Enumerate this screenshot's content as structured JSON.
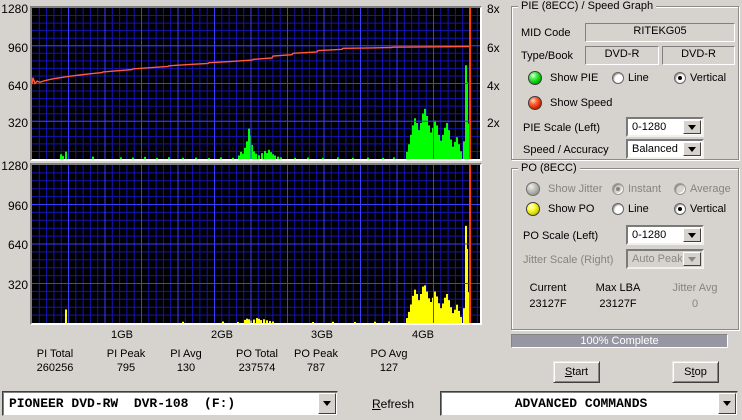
{
  "colors": {
    "bg": "#d6d3ce",
    "grid_minor": "#1414b4",
    "grid_major": "#3c3cff",
    "pie_bar": "#00ff00",
    "po_bar": "#ffff00",
    "speed_line": "#ff5a3c",
    "marker": "#ff3c00",
    "progress_fill": "#9797a4"
  },
  "chart_data": {
    "type": "bar",
    "pie_graph": {
      "title": "PIE (8ECC)",
      "ylim": [
        0,
        1280
      ],
      "y_ticks": [
        "1280",
        "960",
        "640",
        "320"
      ],
      "right_ticks": [
        "8x",
        "6x",
        "4x",
        "2x"
      ],
      "marker_x": 438,
      "bars": [
        [
          28,
          40
        ],
        [
          30,
          26
        ],
        [
          33,
          62
        ],
        [
          60,
          20
        ],
        [
          88,
          14
        ],
        [
          100,
          12
        ],
        [
          112,
          18
        ],
        [
          124,
          10
        ],
        [
          136,
          15
        ],
        [
          150,
          10
        ],
        [
          163,
          12
        ],
        [
          176,
          8
        ],
        [
          188,
          14
        ],
        [
          200,
          10
        ],
        [
          206,
          30
        ],
        [
          208,
          60
        ],
        [
          210,
          45
        ],
        [
          212,
          95
        ],
        [
          214,
          150
        ],
        [
          216,
          258
        ],
        [
          217,
          200
        ],
        [
          219,
          120
        ],
        [
          221,
          65
        ],
        [
          223,
          45
        ],
        [
          226,
          32
        ],
        [
          229,
          50
        ],
        [
          232,
          68
        ],
        [
          234,
          50
        ],
        [
          236,
          78
        ],
        [
          238,
          58
        ],
        [
          240,
          40
        ],
        [
          242,
          30
        ],
        [
          245,
          20
        ],
        [
          248,
          14
        ],
        [
          262,
          10
        ],
        [
          275,
          12
        ],
        [
          290,
          10
        ],
        [
          305,
          14
        ],
        [
          320,
          10
        ],
        [
          335,
          12
        ],
        [
          350,
          10
        ],
        [
          361,
          14
        ],
        [
          374,
          60
        ],
        [
          376,
          125
        ],
        [
          378,
          205
        ],
        [
          380,
          285
        ],
        [
          382,
          345
        ],
        [
          384,
          305
        ],
        [
          386,
          245
        ],
        [
          388,
          305
        ],
        [
          390,
          385
        ],
        [
          392,
          425
        ],
        [
          394,
          365
        ],
        [
          396,
          285
        ],
        [
          398,
          225
        ],
        [
          400,
          265
        ],
        [
          402,
          325
        ],
        [
          404,
          285
        ],
        [
          406,
          205
        ],
        [
          408,
          155
        ],
        [
          410,
          205
        ],
        [
          412,
          265
        ],
        [
          414,
          305
        ],
        [
          416,
          245
        ],
        [
          418,
          165
        ],
        [
          420,
          105
        ],
        [
          422,
          145
        ],
        [
          424,
          185
        ],
        [
          426,
          125
        ],
        [
          428,
          65
        ],
        [
          431,
          150
        ],
        [
          433,
          795
        ],
        [
          434,
          650
        ],
        [
          435,
          300
        ]
      ],
      "speed_line": [
        [
          0,
          635
        ],
        [
          1,
          690
        ],
        [
          3,
          640
        ],
        [
          5,
          660
        ],
        [
          8,
          650
        ],
        [
          12,
          662
        ],
        [
          17,
          672
        ],
        [
          23,
          682
        ],
        [
          30,
          692
        ],
        [
          38,
          702
        ],
        [
          48,
          712
        ],
        [
          58,
          722
        ],
        [
          70,
          732
        ],
        [
          71,
          738
        ],
        [
          85,
          748
        ],
        [
          100,
          758
        ],
        [
          101,
          764
        ],
        [
          118,
          774
        ],
        [
          136,
          784
        ],
        [
          137,
          790
        ],
        [
          156,
          800
        ],
        [
          176,
          810
        ],
        [
          177,
          816
        ],
        [
          198,
          826
        ],
        [
          220,
          838
        ],
        [
          221,
          844
        ],
        [
          240,
          856
        ],
        [
          241,
          872
        ],
        [
          260,
          884
        ],
        [
          261,
          896
        ],
        [
          285,
          908
        ],
        [
          286,
          920
        ],
        [
          310,
          930
        ],
        [
          311,
          938
        ],
        [
          340,
          942
        ],
        [
          360,
          945
        ],
        [
          361,
          948
        ],
        [
          390,
          950
        ],
        [
          420,
          952
        ],
        [
          438,
          953
        ]
      ]
    },
    "po_graph": {
      "title": "PO (8ECC)",
      "ylim": [
        0,
        1280
      ],
      "y_ticks": [
        "1280",
        "960",
        "640",
        "320"
      ],
      "marker_x": 438,
      "bars": [
        [
          33,
          110
        ],
        [
          150,
          10
        ],
        [
          190,
          12
        ],
        [
          205,
          8
        ],
        [
          212,
          25
        ],
        [
          214,
          35
        ],
        [
          216,
          30
        ],
        [
          218,
          20
        ],
        [
          221,
          28
        ],
        [
          224,
          40
        ],
        [
          226,
          34
        ],
        [
          228,
          24
        ],
        [
          231,
          30
        ],
        [
          234,
          22
        ],
        [
          237,
          16
        ],
        [
          240,
          12
        ],
        [
          280,
          8
        ],
        [
          300,
          10
        ],
        [
          322,
          8
        ],
        [
          342,
          10
        ],
        [
          356,
          12
        ],
        [
          374,
          40
        ],
        [
          376,
          90
        ],
        [
          378,
          150
        ],
        [
          380,
          220
        ],
        [
          382,
          270
        ],
        [
          384,
          235
        ],
        [
          386,
          185
        ],
        [
          388,
          235
        ],
        [
          390,
          295
        ],
        [
          392,
          305
        ],
        [
          394,
          255
        ],
        [
          396,
          200
        ],
        [
          398,
          170
        ],
        [
          400,
          205
        ],
        [
          402,
          255
        ],
        [
          404,
          215
        ],
        [
          406,
          160
        ],
        [
          408,
          120
        ],
        [
          410,
          158
        ],
        [
          412,
          205
        ],
        [
          414,
          235
        ],
        [
          416,
          185
        ],
        [
          418,
          128
        ],
        [
          420,
          80
        ],
        [
          422,
          108
        ],
        [
          424,
          148
        ],
        [
          426,
          98
        ],
        [
          428,
          50
        ],
        [
          431,
          120
        ],
        [
          433,
          787
        ],
        [
          434,
          600
        ],
        [
          435,
          250
        ]
      ]
    },
    "x_ticks": [
      {
        "label": "1GB",
        "px": 91
      },
      {
        "label": "2GB",
        "px": 191
      },
      {
        "label": "3GB",
        "px": 291
      },
      {
        "label": "4GB",
        "px": 392
      }
    ]
  },
  "stats": [
    {
      "label": "PI Total",
      "value": "260256"
    },
    {
      "label": "PI Peak",
      "value": "795"
    },
    {
      "label": "PI Avg",
      "value": "130"
    },
    {
      "label": "PO Total",
      "value": "237574"
    },
    {
      "label": "PO Peak",
      "value": "787"
    },
    {
      "label": "PO Avg",
      "value": "127"
    }
  ],
  "pie_panel": {
    "title": "PIE (8ECC) / Speed Graph",
    "mid_code_label": "MID Code",
    "mid_code": "RITEKG05",
    "type_book_label": "Type/Book",
    "type_book_1": "DVD-R",
    "type_book_2": "DVD-R",
    "show_pie": "Show PIE",
    "show_speed": "Show Speed",
    "line_label": "Line",
    "vertical_label": "Vertical",
    "pie_scale_label": "PIE Scale (Left)",
    "pie_scale_value": "0-1280",
    "speed_accuracy_label": "Speed / Accuracy",
    "speed_accuracy_value": "Balanced"
  },
  "po_panel": {
    "title": "PO (8ECC)",
    "show_jitter": "Show Jitter",
    "instant": "Instant",
    "average": "Average",
    "show_po": "Show PO",
    "line_label": "Line",
    "vertical_label": "Vertical",
    "po_scale_label": "PO Scale (Left)",
    "po_scale_value": "0-1280",
    "jitter_scale_label": "Jitter Scale (Right)",
    "jitter_scale_value": "Auto Peak",
    "current_label": "Current",
    "current_value": "23127F",
    "max_lba_label": "Max LBA",
    "max_lba_value": "23127F",
    "jitter_avg_label": "Jitter Avg",
    "jitter_avg_value": "0"
  },
  "progress": {
    "text": "100% Complete",
    "percent": 100
  },
  "buttons": {
    "start": {
      "text": "Start",
      "key": 0
    },
    "stop": {
      "text": "Stop",
      "key": 1
    }
  },
  "bottom_bar": {
    "device": "PIONEER DVD-RW  DVR-108  (F:)",
    "refresh": {
      "text": "Refresh",
      "key": 0
    },
    "commands": "ADVANCED COMMANDS"
  }
}
